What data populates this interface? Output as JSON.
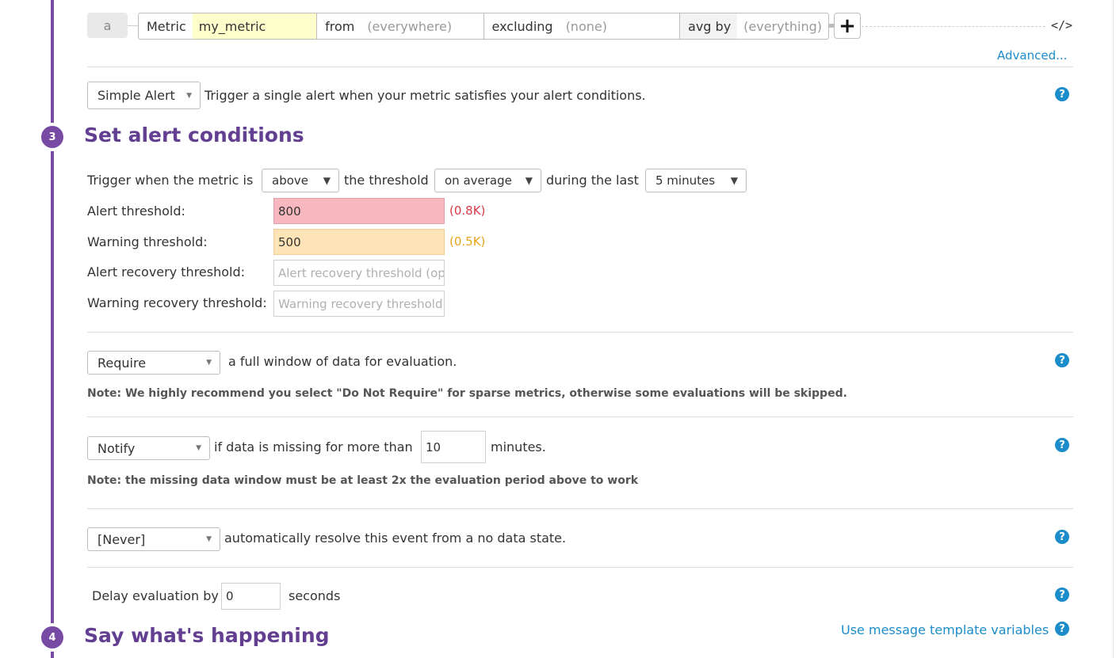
{
  "query": {
    "letter": "a",
    "metric_label": "Metric",
    "metric_value": "my_metric",
    "from_label": "from",
    "from_value": "(everywhere)",
    "excluding_label": "excluding",
    "excluding_value": "(none)",
    "avgby_label": "avg by",
    "avgby_value": "(everything)",
    "code_icon": "</>",
    "advanced_link": "Advanced..."
  },
  "alert_type": {
    "selected": "Simple Alert",
    "description": "Trigger a single alert when your metric satisfies your alert conditions."
  },
  "step3": {
    "number": "3",
    "title": "Set alert conditions"
  },
  "trigger": {
    "prefix": "Trigger when the metric is",
    "comparator": "above",
    "middle": "the threshold",
    "aggregation": "on average",
    "suffix": "during the last",
    "window": "5 minutes"
  },
  "thresholds": {
    "alert_label": "Alert threshold:",
    "alert_value": "800",
    "alert_hint": "(0.8K)",
    "warning_label": "Warning threshold:",
    "warning_value": "500",
    "warning_hint": "(0.5K)",
    "alert_recovery_label": "Alert recovery threshold:",
    "alert_recovery_placeholder": "Alert recovery threshold (op",
    "warning_recovery_label": "Warning recovery threshold:",
    "warning_recovery_placeholder": "Warning recovery threshold"
  },
  "full_window": {
    "selected": "Require",
    "text": "a full window of data for evaluation.",
    "note": "Note: We highly recommend you select \"Do Not Require\" for sparse metrics, otherwise some evaluations will be skipped."
  },
  "missing_data": {
    "selected": "Notify",
    "text_before": "if data is missing for more than",
    "minutes_value": "10",
    "text_after": "minutes.",
    "note": "Note: the missing data window must be at least 2x the evaluation period above to work"
  },
  "auto_resolve": {
    "selected": "[Never]",
    "text": "automatically resolve this event from a no data state."
  },
  "delay": {
    "prefix": "Delay evaluation by",
    "value": "0",
    "suffix": "seconds"
  },
  "step4": {
    "number": "4",
    "title": "Say what's happening",
    "template_link": "Use message template variables"
  },
  "icons": {
    "help": "?",
    "plus": "+",
    "caret": "▼"
  },
  "colors": {
    "accent_purple": "#774aa4",
    "title_purple": "#633f91",
    "link_blue": "#1c8dca",
    "alert_bg": "#f7b8bf",
    "warning_bg": "#fde3b5",
    "alert_text": "#d93a43",
    "warning_text": "#e8a319"
  }
}
